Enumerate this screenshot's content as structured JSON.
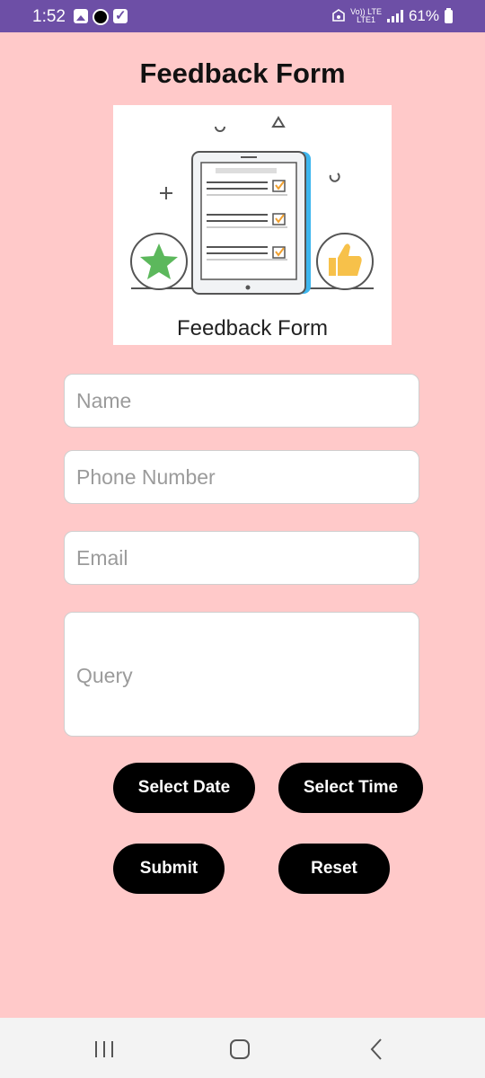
{
  "status_bar": {
    "time": "1:52",
    "network_top": "Vo)) LTE",
    "network_bottom": "LTE1",
    "battery": "61%",
    "icons": [
      "gallery-icon",
      "snapchat-icon",
      "checkbox-icon",
      "data-saver-icon",
      "signal-icon",
      "battery-icon"
    ]
  },
  "page": {
    "title": "Feedback Form"
  },
  "hero": {
    "caption": "Feedback Form",
    "icons": [
      "clipboard-icon",
      "star-icon",
      "thumbs-up-icon"
    ],
    "colors": {
      "star": "#5cb85c",
      "thumb": "#f7c14a",
      "tablet_edge": "#3db6ee"
    }
  },
  "form": {
    "name_placeholder": "Name",
    "phone_placeholder": "Phone Number",
    "email_placeholder": "Email",
    "query_placeholder": "Query"
  },
  "buttons": {
    "select_date": "Select Date",
    "select_time": "Select Time",
    "submit": "Submit",
    "reset": "Reset"
  },
  "nav_bar": {
    "icons": [
      "recent-apps-icon",
      "home-icon",
      "back-icon"
    ]
  },
  "colors": {
    "background": "#ffc9c9",
    "status_bar": "#6d4fa6",
    "button": "#000000",
    "nav_bar": "#f3f3f3"
  }
}
